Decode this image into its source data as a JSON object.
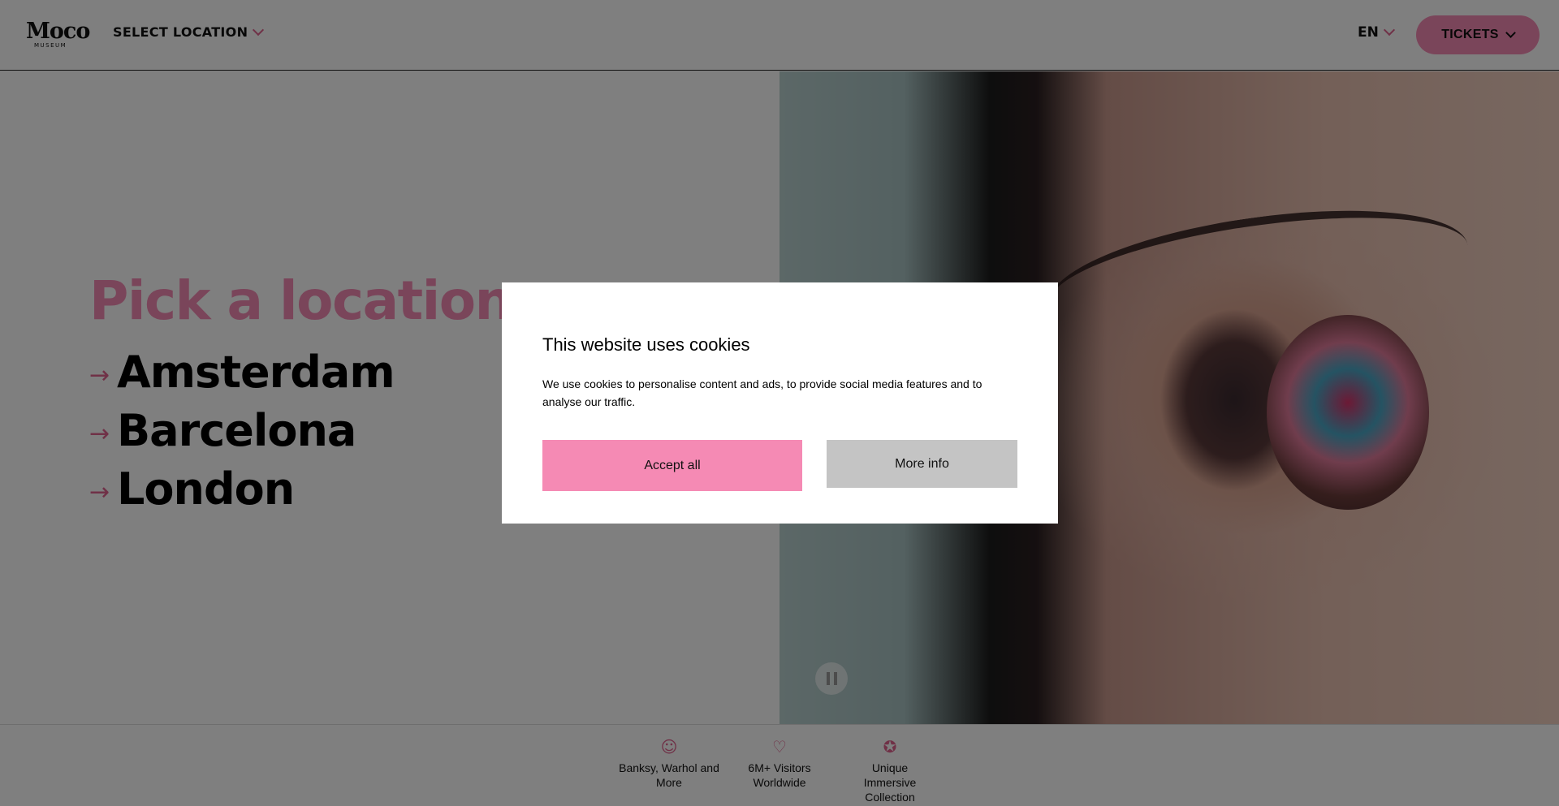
{
  "header": {
    "logo_text": "Moco",
    "logo_sub": "MUSEUM",
    "select_location": "SELECT LOCATION",
    "language": "EN",
    "tickets": "TICKETS"
  },
  "hero": {
    "title": "Pick a location",
    "locations": [
      {
        "label": "Amsterdam"
      },
      {
        "label": "Barcelona"
      },
      {
        "label": "London"
      }
    ],
    "arrow_icon": "arrow-right-icon"
  },
  "usps": [
    {
      "icon": "face-icon",
      "label": "Banksy, Warhol and More"
    },
    {
      "icon": "heart-icon",
      "label": "6M+ Visitors Worldwide"
    },
    {
      "icon": "star-badge-icon",
      "label": "Unique Immersive Collection"
    }
  ],
  "cookie_dialog": {
    "title": "This website uses cookies",
    "body": "We use cookies to personalise content and ads, to provide social media features and to analyse our traffic.",
    "accept_label": "Accept all",
    "more_label": "More info"
  },
  "colors": {
    "brand_pink": "#f58ab4",
    "accent_pink": "#e0638f",
    "more_info_gray": "#c4c4c4"
  }
}
